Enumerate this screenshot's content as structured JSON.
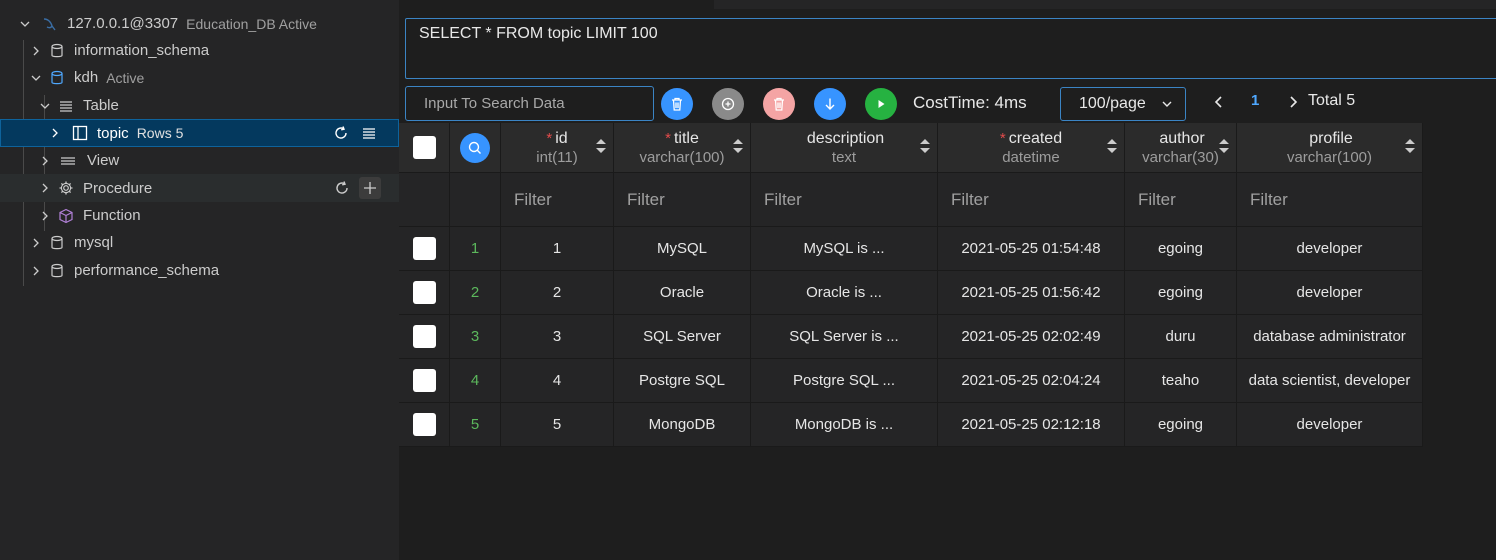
{
  "sidebar": {
    "connection": {
      "label": "127.0.0.1@3307",
      "desc": "Education_DB Active"
    },
    "dbs": [
      {
        "label": "information_schema"
      },
      {
        "label": "kdh",
        "desc": "Active"
      },
      {
        "label": "mysql"
      },
      {
        "label": "performance_schema"
      }
    ],
    "folders": {
      "table": "Table",
      "view": "View",
      "procedure": "Procedure",
      "function": "Function"
    },
    "table_item": {
      "label": "topic",
      "desc": "Rows 5"
    }
  },
  "editor": {
    "query": "SELECT * FROM topic LIMIT 100"
  },
  "toolbar": {
    "search_placeholder": "Input To Search Data",
    "cost_time": "CostTime: 4ms",
    "page_size": "100/page",
    "current_page": "1",
    "total": "Total 5",
    "colors": {
      "delete": "#3794ff",
      "insert": "#8a8a8a",
      "remove": "#f4a4a4",
      "export": "#3794ff",
      "run": "#26b241"
    }
  },
  "table": {
    "columns": [
      {
        "name": "id",
        "type": "int(11)",
        "required": "*"
      },
      {
        "name": "title",
        "type": "varchar(100)",
        "required": "*"
      },
      {
        "name": "description",
        "type": "text",
        "required": ""
      },
      {
        "name": "created",
        "type": "datetime",
        "required": "*"
      },
      {
        "name": "author",
        "type": "varchar(30)",
        "required": ""
      },
      {
        "name": "profile",
        "type": "varchar(100)",
        "required": ""
      }
    ],
    "filter_placeholder": "Filter",
    "rows": [
      {
        "num": "1",
        "cells": [
          "1",
          "MySQL",
          "MySQL is ...",
          "2021-05-25 01:54:48",
          "egoing",
          "developer"
        ]
      },
      {
        "num": "2",
        "cells": [
          "2",
          "Oracle",
          "Oracle is ...",
          "2021-05-25 01:56:42",
          "egoing",
          "developer"
        ]
      },
      {
        "num": "3",
        "cells": [
          "3",
          "SQL Server",
          "SQL Server is ...",
          "2021-05-25 02:02:49",
          "duru",
          "database administrator"
        ]
      },
      {
        "num": "4",
        "cells": [
          "4",
          "Postgre SQL",
          "Postgre SQL ...",
          "2021-05-25 02:04:24",
          "teaho",
          "data scientist, developer"
        ]
      },
      {
        "num": "5",
        "cells": [
          "5",
          "MongoDB",
          "MongoDB is ...",
          "2021-05-25 02:12:18",
          "egoing",
          "developer"
        ]
      }
    ]
  }
}
